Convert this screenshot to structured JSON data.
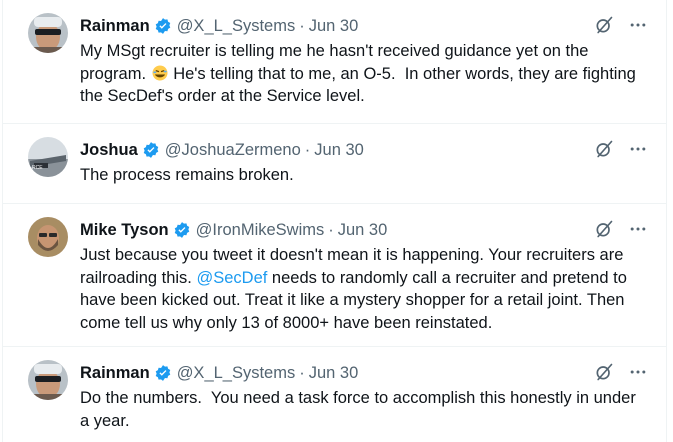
{
  "tweets": [
    {
      "name": "Rainman",
      "handle": "@X_L_Systems",
      "dot": "·",
      "date": "Jun 30",
      "avatar_icon": "sunglasses-man-avatar",
      "text_before": "My MSgt recruiter is telling me he hasn't received guidance yet on the program. ",
      "emoji": "rolling-on-floor-laughing-emoji",
      "text_after": " He's telling that to me, an O-5.  In other words, they are fighting the SecDef's order at the Service level."
    },
    {
      "name": "Joshua",
      "handle": "@JoshuaZermeno",
      "dot": "·",
      "date": "Jun 30",
      "avatar_icon": "aircraft-avatar",
      "text": "The process remains broken."
    },
    {
      "name": "Mike Tyson",
      "handle": "@IronMikeSwims",
      "dot": "·",
      "date": "Jun 30",
      "avatar_icon": "bearded-man-avatar",
      "text_before": "Just because you tweet it doesn't mean it is happening. Your recruiters are railroading this. ",
      "mention": "@SecDef",
      "text_after": " needs to randomly call a recruiter and pretend to have been kicked out. Treat it like a mystery shopper for a retail joint. Then come tell us why only 13 of 8000+ have been reinstated."
    },
    {
      "name": "Rainman",
      "handle": "@X_L_Systems",
      "dot": "·",
      "date": "Jun 30",
      "avatar_icon": "sunglasses-man-avatar",
      "text": "Do the numbers.  You need a task force to accomplish this honestly in under a year."
    }
  ],
  "colors": {
    "text": "#0f1419",
    "secondary": "#536471",
    "link": "#1d9bf0",
    "verified": "#1d9bf0",
    "divider": "#eff3f4"
  }
}
